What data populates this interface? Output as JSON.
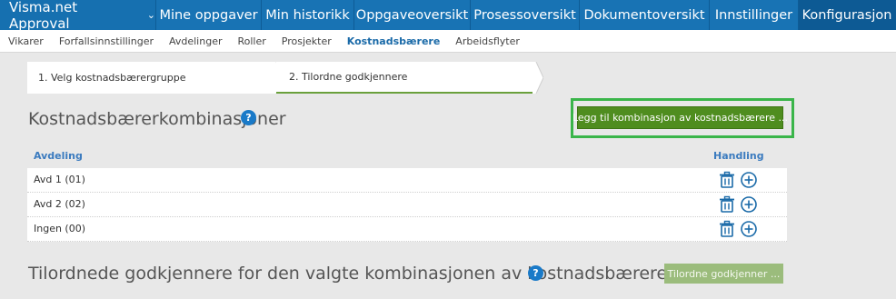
{
  "topnav": {
    "brand": "Visma.net Approval",
    "tabs": [
      "Mine oppgaver",
      "Min historikk",
      "Oppgaveoversikt",
      "Prosessoversikt",
      "Dokumentoversikt",
      "Innstillinger",
      "Konfigurasjon"
    ],
    "active_tab": "Konfigurasjon"
  },
  "subnav": {
    "items": [
      "Vikarer",
      "Forfallsinnstillinger",
      "Avdelinger",
      "Roller",
      "Prosjekter",
      "Kostnadsbærere",
      "Arbeidsflyter"
    ],
    "active": "Kostnadsbærere"
  },
  "stepper": {
    "step1": "1. Velg kostnadsbærergruppe",
    "step2": "2. Tilordne godkjennere",
    "active_step": 2
  },
  "combinations": {
    "title": "Kostnadsbærerkombinasjoner",
    "help_icon": "?",
    "add_button": "Legg til kombinasjon av kostnadsbærere ...",
    "columns": {
      "dept": "Avdeling",
      "action": "Handling"
    },
    "rows": [
      {
        "dept": "Avd 1 (01)"
      },
      {
        "dept": "Avd 2 (02)"
      },
      {
        "dept": "Ingen (00)"
      }
    ]
  },
  "assigned": {
    "title": "Tilordnede godkjennere for den valgte kombinasjonen av kostnadsbærere",
    "help_icon": "?",
    "assign_button": "Tilordne godkjenner ..."
  },
  "colors": {
    "nav_blue": "#1873b4",
    "active_nav": "#0d5a94",
    "primary_green": "#4f8d1f",
    "disabled_green": "#9bbc7c",
    "highlight_frame": "#3ab54a",
    "icon_blue": "#1a6aa8"
  }
}
